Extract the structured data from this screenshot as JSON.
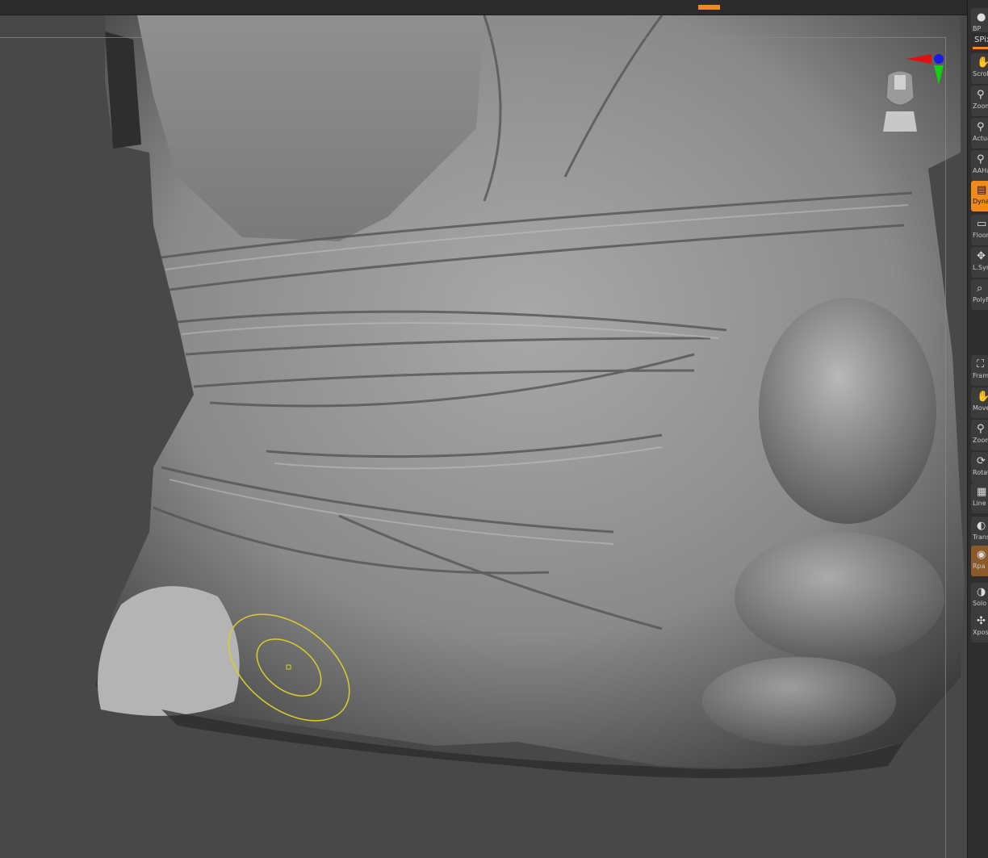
{
  "window": {
    "title": "ZBrush sculpt viewport"
  },
  "colors": {
    "accent": "#f08a1c",
    "brush_ring": "#d8cf2a",
    "canvas": "#484848"
  },
  "shelf": {
    "top_item": {
      "label": "BP",
      "icon": "material-sphere-icon"
    },
    "spix": {
      "label": "SPix"
    },
    "buttons": [
      {
        "label": "Scroll",
        "icon": "hand-icon",
        "active": false
      },
      {
        "label": "Zoom",
        "icon": "magnifier-icon",
        "active": false
      },
      {
        "label": "Actual",
        "icon": "magnifier-icon",
        "active": false
      },
      {
        "label": "AAHalf",
        "icon": "magnifier-icon",
        "active": false
      },
      {
        "label": "Dynamic Persp",
        "icon": "perspective-icon",
        "active": true
      },
      {
        "label": "Floor",
        "icon": "floor-icon",
        "active": false
      },
      {
        "label": "L.Sym",
        "icon": "symmetry-icon",
        "active": false
      },
      {
        "label": "PolyF",
        "icon": "polyframe-icon",
        "active": false
      },
      {
        "label": "Frame",
        "icon": "frame-icon",
        "active": false
      },
      {
        "label": "Move",
        "icon": "hand-icon",
        "active": false
      },
      {
        "label": "Zoom3D",
        "icon": "magnifier-icon",
        "active": false
      },
      {
        "label": "Rotate",
        "icon": "rotate-icon",
        "active": false
      },
      {
        "label": "Line Fill PolyF",
        "icon": "grid-icon",
        "active": false
      },
      {
        "label": "Transp",
        "icon": "transparency-icon",
        "active": false
      },
      {
        "label": "Rpa",
        "icon": "solo-icon",
        "active": false
      },
      {
        "label": "Solo",
        "icon": "toggle-icon",
        "active": false
      },
      {
        "label": "Xpose",
        "icon": "xpose-icon",
        "active": false
      }
    ]
  }
}
